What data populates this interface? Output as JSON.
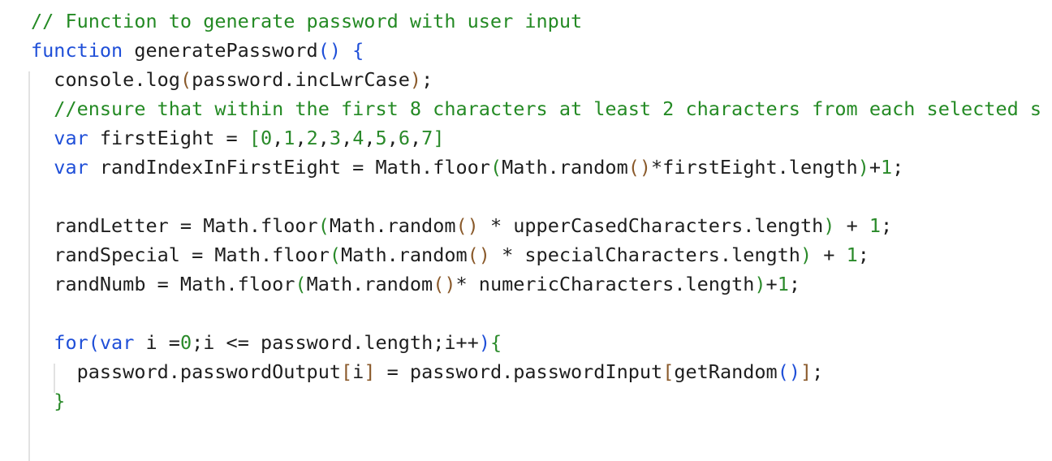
{
  "colors": {
    "comment": "#248a24",
    "keyword": "#1f4fd8",
    "bracket_outer": "#2f6fd6",
    "bracket_inner": "#8a5a2b",
    "number": "#2a8a2a",
    "text": "#1e1e1e",
    "indent_guide": "#e2e2e2"
  },
  "lines": [
    [
      [
        "// Function to generate password with user input",
        "comment"
      ]
    ],
    [
      [
        "function",
        "keyword"
      ],
      [
        " generatePassword",
        "text"
      ],
      [
        "()",
        "keyword"
      ],
      [
        " {",
        "keyword"
      ]
    ],
    [
      [
        "  console.log",
        "text"
      ],
      [
        "(",
        "bracket_inner"
      ],
      [
        "password.incLwrCase",
        "text"
      ],
      [
        ")",
        "bracket_inner"
      ],
      [
        ";",
        "text"
      ]
    ],
    [
      [
        "  //ensure that within the first 8 characters at least 2 characters from each selected s",
        "comment"
      ]
    ],
    [
      [
        "  ",
        "text"
      ],
      [
        "var",
        "keyword"
      ],
      [
        " firstEight = ",
        "text"
      ],
      [
        "[",
        "number"
      ],
      [
        "0",
        "number"
      ],
      [
        ",",
        "text"
      ],
      [
        "1",
        "number"
      ],
      [
        ",",
        "text"
      ],
      [
        "2",
        "number"
      ],
      [
        ",",
        "text"
      ],
      [
        "3",
        "number"
      ],
      [
        ",",
        "text"
      ],
      [
        "4",
        "number"
      ],
      [
        ",",
        "text"
      ],
      [
        "5",
        "number"
      ],
      [
        ",",
        "text"
      ],
      [
        "6",
        "number"
      ],
      [
        ",",
        "text"
      ],
      [
        "7",
        "number"
      ],
      [
        "]",
        "number"
      ]
    ],
    [
      [
        "  ",
        "text"
      ],
      [
        "var",
        "keyword"
      ],
      [
        " randIndexInFirstEight = Math.floor",
        "text"
      ],
      [
        "(",
        "number"
      ],
      [
        "Math.random",
        "text"
      ],
      [
        "()",
        "bracket_inner"
      ],
      [
        "*firstEight.length",
        "text"
      ],
      [
        ")",
        "number"
      ],
      [
        "+",
        "text"
      ],
      [
        "1",
        "number"
      ],
      [
        ";",
        "text"
      ]
    ],
    [
      [
        "",
        "text"
      ]
    ],
    [
      [
        "  randLetter = Math.floor",
        "text"
      ],
      [
        "(",
        "number"
      ],
      [
        "Math.random",
        "text"
      ],
      [
        "()",
        "bracket_inner"
      ],
      [
        " * upperCasedCharacters.length",
        "text"
      ],
      [
        ")",
        "number"
      ],
      [
        " + ",
        "text"
      ],
      [
        "1",
        "number"
      ],
      [
        ";",
        "text"
      ]
    ],
    [
      [
        "  randSpecial = Math.floor",
        "text"
      ],
      [
        "(",
        "number"
      ],
      [
        "Math.random",
        "text"
      ],
      [
        "()",
        "bracket_inner"
      ],
      [
        " * specialCharacters.length",
        "text"
      ],
      [
        ")",
        "number"
      ],
      [
        " + ",
        "text"
      ],
      [
        "1",
        "number"
      ],
      [
        ";",
        "text"
      ]
    ],
    [
      [
        "  randNumb = Math.floor",
        "text"
      ],
      [
        "(",
        "number"
      ],
      [
        "Math.random",
        "text"
      ],
      [
        "()",
        "bracket_inner"
      ],
      [
        "* numericCharacters.length",
        "text"
      ],
      [
        ")",
        "number"
      ],
      [
        "+",
        "text"
      ],
      [
        "1",
        "number"
      ],
      [
        ";",
        "text"
      ]
    ],
    [
      [
        "",
        "text"
      ]
    ],
    [
      [
        "  ",
        "text"
      ],
      [
        "for",
        "keyword"
      ],
      [
        "(",
        "keyword"
      ],
      [
        "var",
        "keyword"
      ],
      [
        " i =",
        "text"
      ],
      [
        "0",
        "number"
      ],
      [
        ";i <= password.length;i++",
        "text"
      ],
      [
        ")",
        "keyword"
      ],
      [
        "{",
        "number"
      ]
    ],
    [
      [
        "    password.passwordOutput",
        "text"
      ],
      [
        "[",
        "bracket_inner"
      ],
      [
        "i",
        "text"
      ],
      [
        "]",
        "bracket_inner"
      ],
      [
        " = password.passwordInput",
        "text"
      ],
      [
        "[",
        "bracket_inner"
      ],
      [
        "getRandom",
        "text"
      ],
      [
        "()",
        "keyword"
      ],
      [
        "]",
        "bracket_inner"
      ],
      [
        ";",
        "text"
      ]
    ],
    [
      [
        "  ",
        "text"
      ],
      [
        "}",
        "number"
      ]
    ]
  ]
}
